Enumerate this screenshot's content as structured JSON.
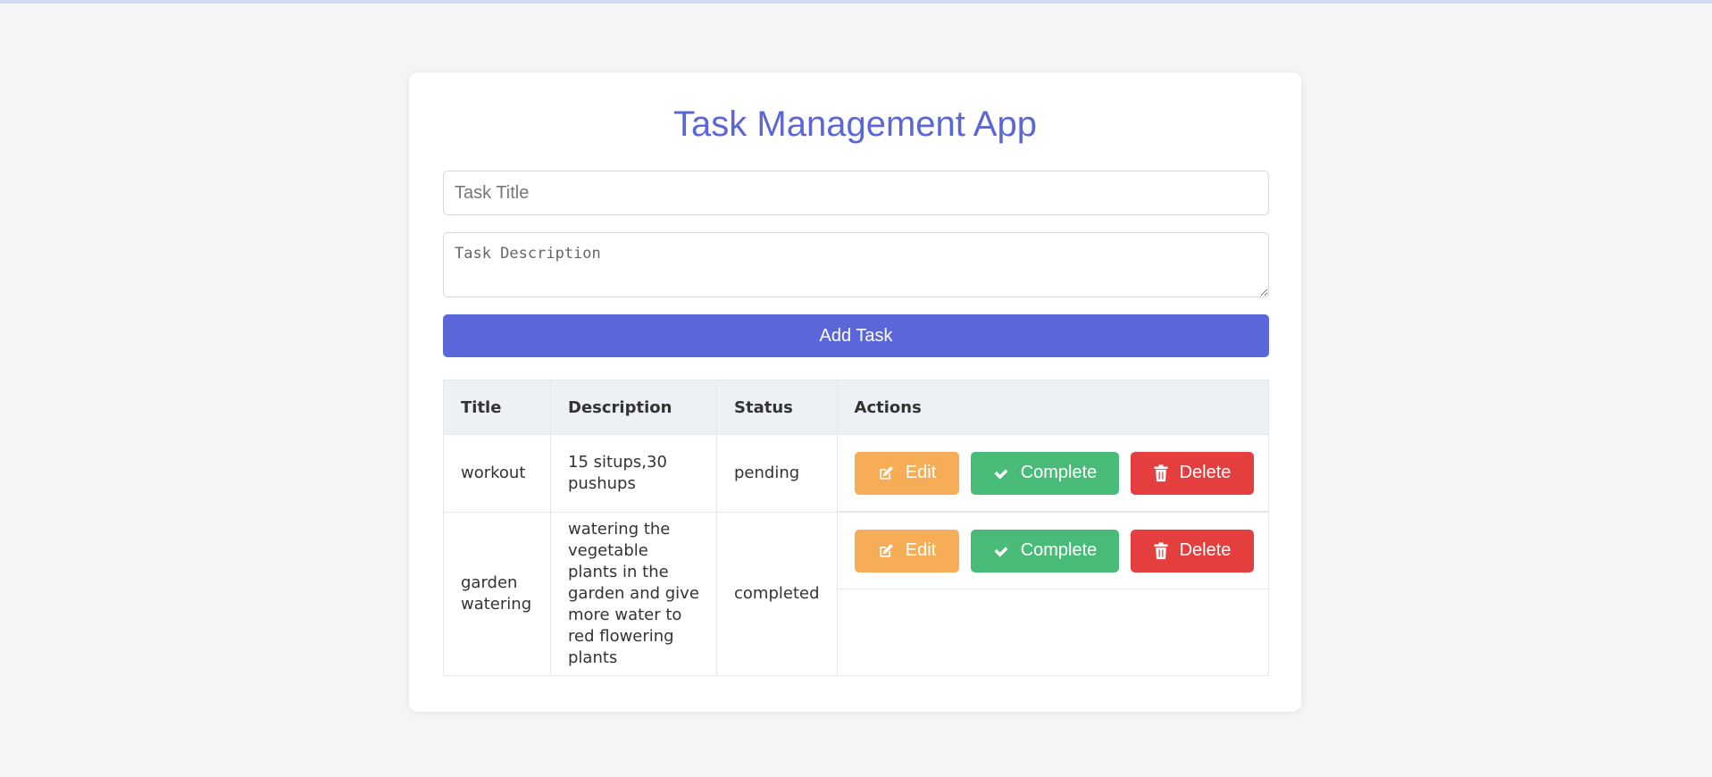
{
  "app": {
    "title": "Task Management App"
  },
  "form": {
    "title_placeholder": "Task Title",
    "title_value": "",
    "description_placeholder": "Task Description",
    "description_value": "",
    "add_button_label": "Add Task"
  },
  "table": {
    "headers": {
      "title": "Title",
      "description": "Description",
      "status": "Status",
      "actions": "Actions"
    },
    "rows": [
      {
        "title": "workout",
        "description": "15 situps,30 pushups",
        "status": "pending"
      },
      {
        "title": "garden watering",
        "description": "watering the vegetable plants in the garden and give more water to red flowering plants",
        "status": "completed"
      }
    ],
    "actions": {
      "edit_label": "Edit",
      "complete_label": "Complete",
      "delete_label": "Delete"
    }
  },
  "icons": {
    "edit": "edit-icon",
    "complete": "check-icon",
    "delete": "trash-icon"
  },
  "colors": {
    "background": "#f4f5f4",
    "accent": "#5b67d8",
    "edit": "#f6ad55",
    "complete": "#48bb78",
    "delete": "#e53e3e",
    "table_header": "#edf1f5"
  }
}
